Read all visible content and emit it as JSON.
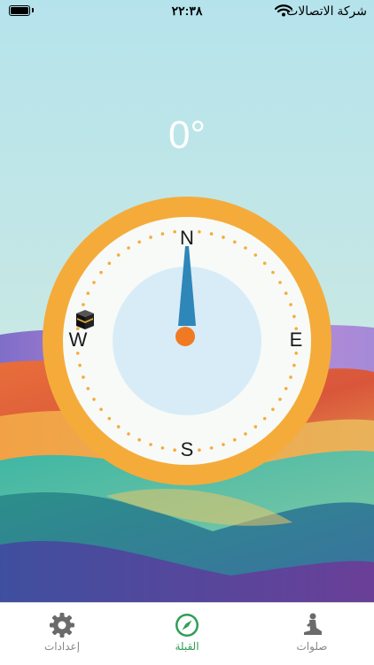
{
  "status_bar": {
    "time": "٢٢:٣٨",
    "carrier": "شركة الاتصالات"
  },
  "qibla": {
    "heading": "0°",
    "directions": {
      "north": "N",
      "east": "E",
      "south": "S",
      "west": "W"
    }
  },
  "tabs": [
    {
      "label": "إعدادات",
      "icon": "gear-icon"
    },
    {
      "label": "القبلة",
      "icon": "compass-icon",
      "active": true
    },
    {
      "label": "صلوات",
      "icon": "prayer-icon"
    }
  ],
  "colors": {
    "ring": "#f5ab3a",
    "needle": "#2f86b8",
    "pivot": "#f07a24",
    "active_tab": "#2f9e57",
    "inactive_tab": "#888888"
  }
}
